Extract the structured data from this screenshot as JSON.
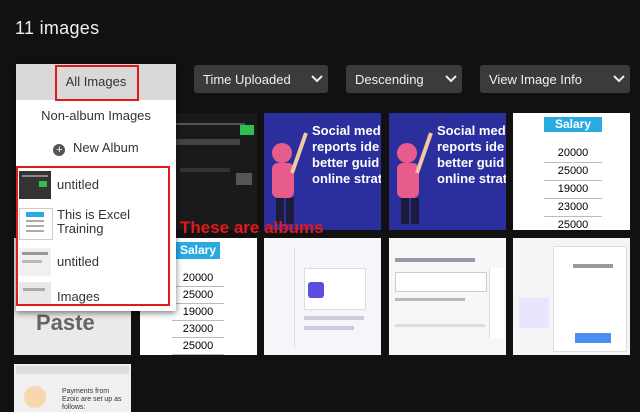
{
  "header": {
    "title": "11 images"
  },
  "filters": [
    {
      "label": "Time Uploaded"
    },
    {
      "label": "Descending"
    },
    {
      "label": "View Image Info"
    }
  ],
  "dropdown": {
    "all_images": "All Images",
    "non_album": "Non-album Images",
    "new_album": "New Album",
    "albums": [
      {
        "label": "untitled"
      },
      {
        "label": "This is Excel Training"
      },
      {
        "label": "untitled"
      },
      {
        "label": "Images"
      }
    ]
  },
  "annotation": "These are albums",
  "social_text": [
    "Social medi",
    "reports ide",
    "better guid",
    "online strat"
  ],
  "salary": {
    "header": "Salary",
    "values": [
      "20000",
      "25000",
      "19000",
      "23000",
      "25000"
    ]
  },
  "paste_text": "Paste",
  "payments_text": "Payments from Ezoic are set up as follows:",
  "colors": {
    "accent_red": "#e01a1a",
    "salary_blue": "#29abe2",
    "social_bg": "#2b2f9e"
  }
}
